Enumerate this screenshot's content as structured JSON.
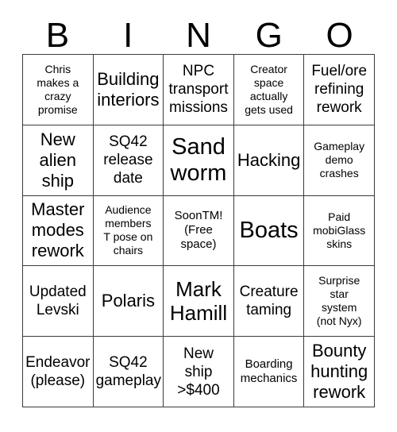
{
  "card": {
    "header_letters": [
      "B",
      "I",
      "N",
      "G",
      "O"
    ],
    "free_space_index": 12,
    "colors": {
      "text": "#000000",
      "grid_line": "#3b3b3b",
      "background": "#ffffff"
    },
    "cells": [
      {
        "text": "Chris\nmakes a\ncrazy\npromise",
        "size": "xs"
      },
      {
        "text": "Building\ninteriors",
        "size": "l"
      },
      {
        "text": "NPC\ntransport\nmissions",
        "size": "m"
      },
      {
        "text": "Creator\nspace\nactually\ngets used",
        "size": "xs"
      },
      {
        "text": "Fuel/ore\nrefining\nrework",
        "size": "m"
      },
      {
        "text": "New\nalien\nship",
        "size": "l"
      },
      {
        "text": "SQ42\nrelease\ndate",
        "size": "m"
      },
      {
        "text": "Sand\nworm",
        "size": "xxl"
      },
      {
        "text": "Hacking",
        "size": "l"
      },
      {
        "text": "Gameplay\ndemo\ncrashes",
        "size": "xs"
      },
      {
        "text": "Master\nmodes\nrework",
        "size": "l"
      },
      {
        "text": "Audience\nmembers\nT pose on\nchairs",
        "size": "xs"
      },
      {
        "text": "SoonTM!\n(Free\nspace)",
        "size": "s"
      },
      {
        "text": "Boats",
        "size": "xxl"
      },
      {
        "text": "Paid\nmobiGlass\nskins",
        "size": "xs"
      },
      {
        "text": "Updated\nLevski",
        "size": "m"
      },
      {
        "text": "Polaris",
        "size": "l"
      },
      {
        "text": "Mark\nHamill",
        "size": "xl"
      },
      {
        "text": "Creature\ntaming",
        "size": "m"
      },
      {
        "text": "Surprise\nstar\nsystem\n(not Nyx)",
        "size": "xs"
      },
      {
        "text": "Endeavor\n(please)",
        "size": "m"
      },
      {
        "text": "SQ42\ngameplay",
        "size": "m"
      },
      {
        "text": "New\nship\n>$400",
        "size": "m"
      },
      {
        "text": "Boarding\nmechanics",
        "size": "s"
      },
      {
        "text": "Bounty\nhunting\nrework",
        "size": "l"
      }
    ]
  }
}
